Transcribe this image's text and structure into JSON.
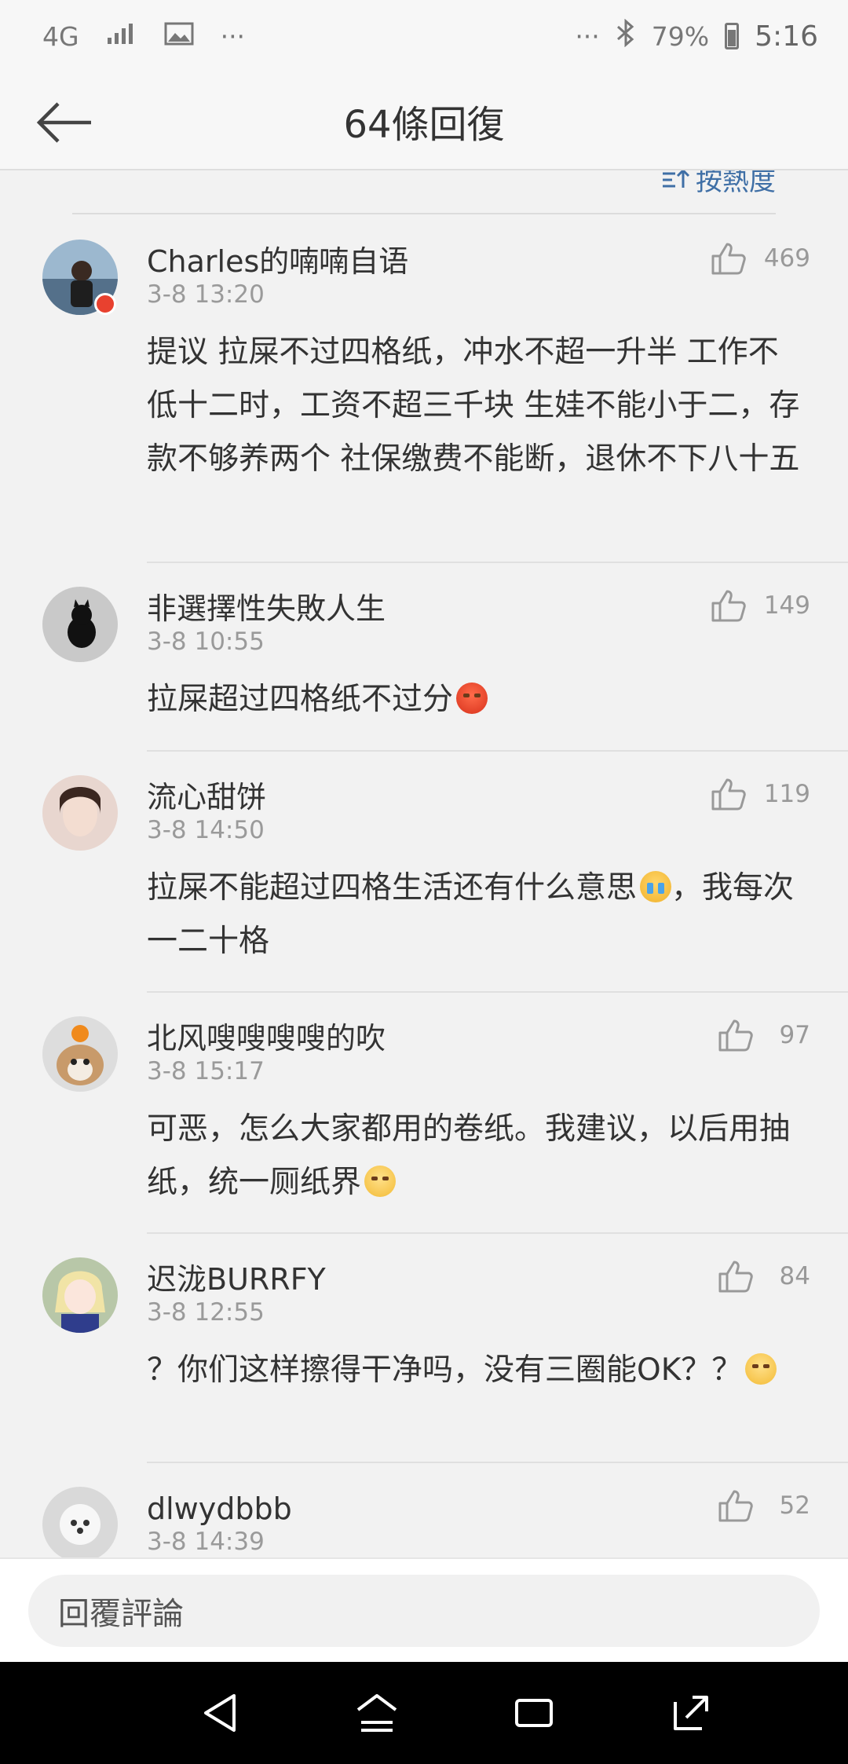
{
  "status_bar": {
    "network": "4G",
    "dots_left": "···",
    "dots_right": "···",
    "battery_pct": "79%",
    "time": "5:16"
  },
  "header": {
    "title": "64條回復"
  },
  "sort": {
    "label": "按熱度"
  },
  "comments": [
    {
      "username": "Charles的喃喃自语",
      "date": "3-8 13:20",
      "text": "提议 拉屎不过四格纸，冲水不超一升半 工作不低十二时，工资不超三千块 生娃不能小于二，存款不够养两个 社保缴费不能断，退休不下八十五",
      "likes": "469"
    },
    {
      "username": "非選擇性失敗人生",
      "date": "3-8 10:55",
      "text": "拉屎超过四格纸不过分",
      "likes": "149"
    },
    {
      "username": "流心甜饼",
      "date": "3-8 14:50",
      "text_a": "拉屎不能超过四格生活还有什么意思",
      "text_b": "，我每次一二十格",
      "likes": "119"
    },
    {
      "username": "北风嗖嗖嗖嗖的吹",
      "date": "3-8 15:17",
      "text": "可恶，怎么大家都用的卷纸。我建议，以后用抽纸，统一厕纸界",
      "likes": "97"
    },
    {
      "username": "迟泷BURRFY",
      "date": "3-8 12:55",
      "text": "？你们这样擦得干净吗，没有三圈能OK？？",
      "likes": "84"
    },
    {
      "username": "dlwydbbb",
      "date": "3-8 14:39",
      "text": "",
      "likes": "52"
    }
  ],
  "reply": {
    "placeholder": "回覆評論"
  }
}
